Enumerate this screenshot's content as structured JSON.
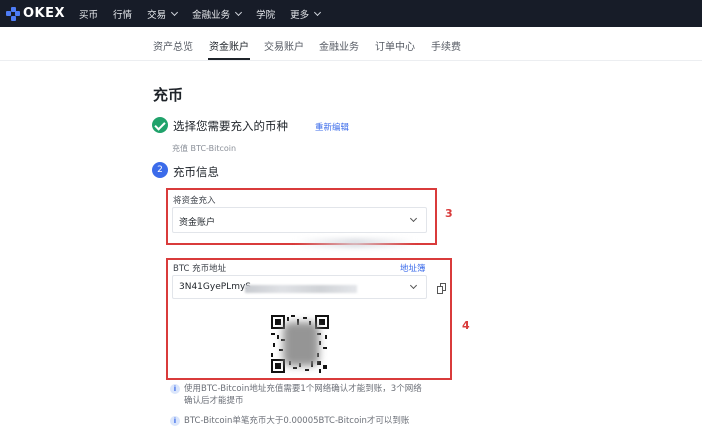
{
  "topbar": {
    "logo_text": "OKEX",
    "nav": [
      {
        "label": "买币",
        "has_dropdown": false
      },
      {
        "label": "行情",
        "has_dropdown": false
      },
      {
        "label": "交易",
        "has_dropdown": true
      },
      {
        "label": "金融业务",
        "has_dropdown": true
      },
      {
        "label": "学院",
        "has_dropdown": false
      },
      {
        "label": "更多",
        "has_dropdown": true
      }
    ]
  },
  "subnav": {
    "tabs": [
      "资产总览",
      "资金账户",
      "交易账户",
      "金融业务",
      "订单中心",
      "手续费"
    ],
    "active_tab": "资金账户"
  },
  "page": {
    "title": "充币",
    "step1": {
      "label": "选择您需要充入的币种",
      "edit_link": "重新编辑",
      "selected": "充值 BTC-Bitcoin"
    },
    "step2": {
      "number": "2",
      "label": "充币信息"
    }
  },
  "deposit_to": {
    "label": "将资金充入",
    "value": "资金账户",
    "annotation": "3"
  },
  "address": {
    "label": "BTC 充币地址",
    "book_link": "地址簿",
    "value": "3N41GyePLmyS",
    "annotation": "4"
  },
  "notes": [
    "使用BTC-Bitcoin地址充值需要1个网络确认才能到账，3个网络确认后才能提币",
    "BTC-Bitcoin单笔充币大于0.00005BTC-Bitcoin才可以到账"
  ],
  "colors": {
    "topbar_bg": "#171c28",
    "accent_blue": "#3b6bea",
    "success_green": "#20a26b",
    "annotation_red": "#d93b3b"
  }
}
